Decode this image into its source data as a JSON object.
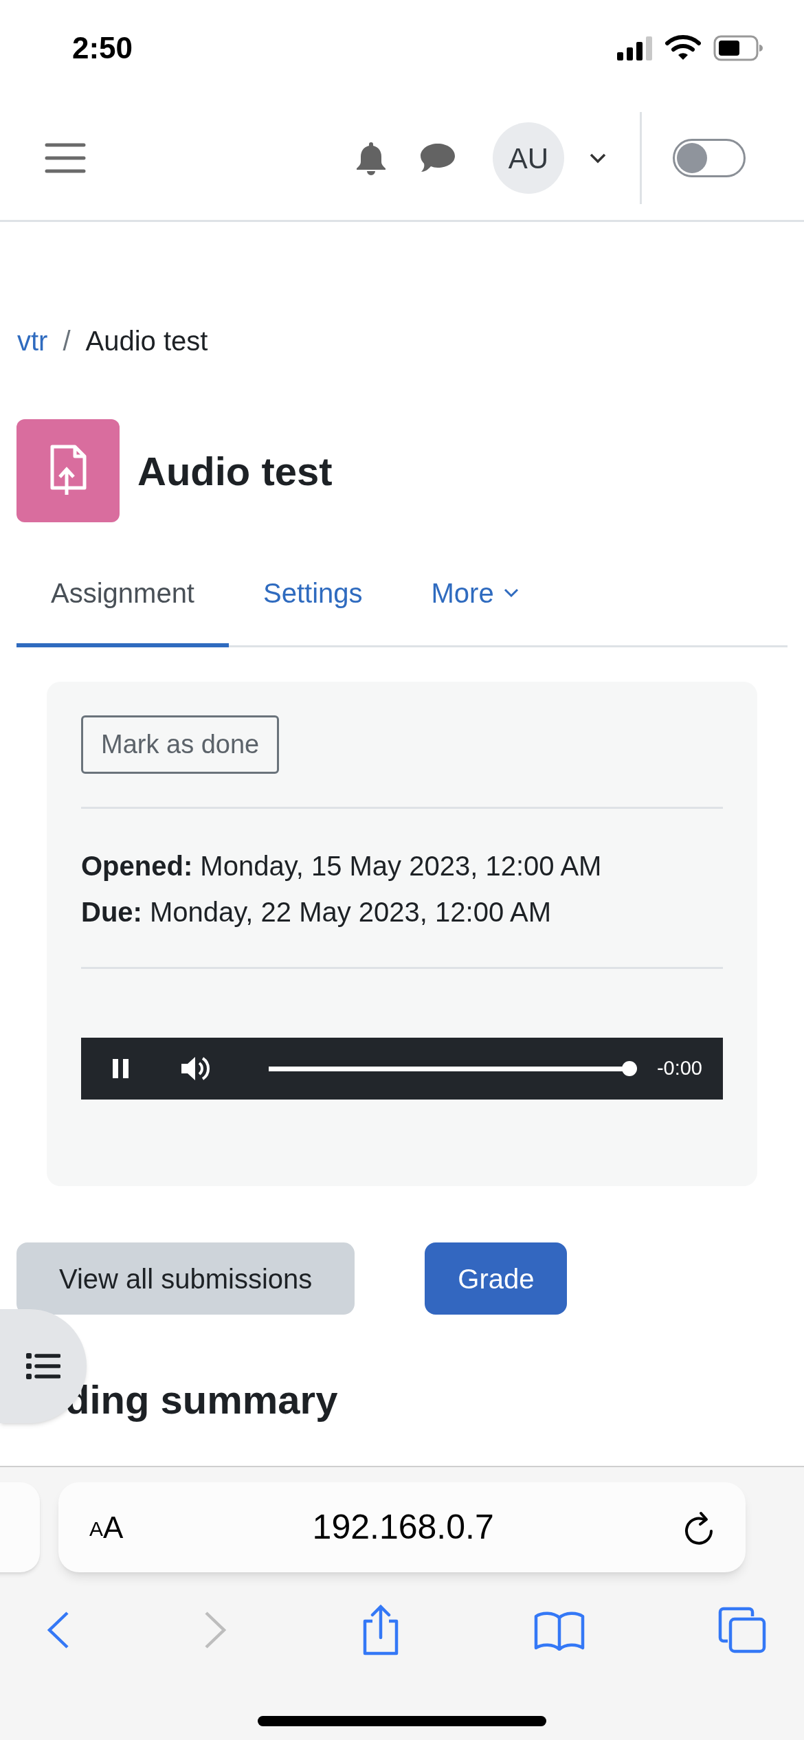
{
  "status_bar": {
    "time": "2:50"
  },
  "navbar": {
    "avatar_initials": "AU",
    "dark_mode_toggle": {
      "on": false
    }
  },
  "breadcrumb": [
    {
      "label": "vtr",
      "kind": "link"
    },
    {
      "label": "/",
      "kind": "separator"
    },
    {
      "label": "Audio test",
      "kind": "current"
    }
  ],
  "page_title": "Audio test",
  "tabs": [
    {
      "label": "Assignment",
      "selected": true,
      "dropdown": false
    },
    {
      "label": "Settings",
      "selected": false,
      "dropdown": false
    },
    {
      "label": "More",
      "selected": false,
      "dropdown": true
    }
  ],
  "mark_done_button": "Mark as done",
  "dates": [
    {
      "label": "Opened:",
      "value": " Monday, 15 May 2023, 12:00 AM"
    },
    {
      "label": "Due:",
      "value": " Monday, 22 May 2023, 12:00 AM"
    }
  ],
  "audio_player": {
    "playing": true,
    "level": 1,
    "time": "-0:00"
  },
  "buttons": [
    {
      "label": "View all submissions",
      "kind": "secondary"
    },
    {
      "label": "Grade",
      "kind": "primary"
    }
  ],
  "section_heading": "ding summary",
  "browser": {
    "text_size_button": "AA",
    "url": "192.168.0.7",
    "forward_enabled": false
  }
}
